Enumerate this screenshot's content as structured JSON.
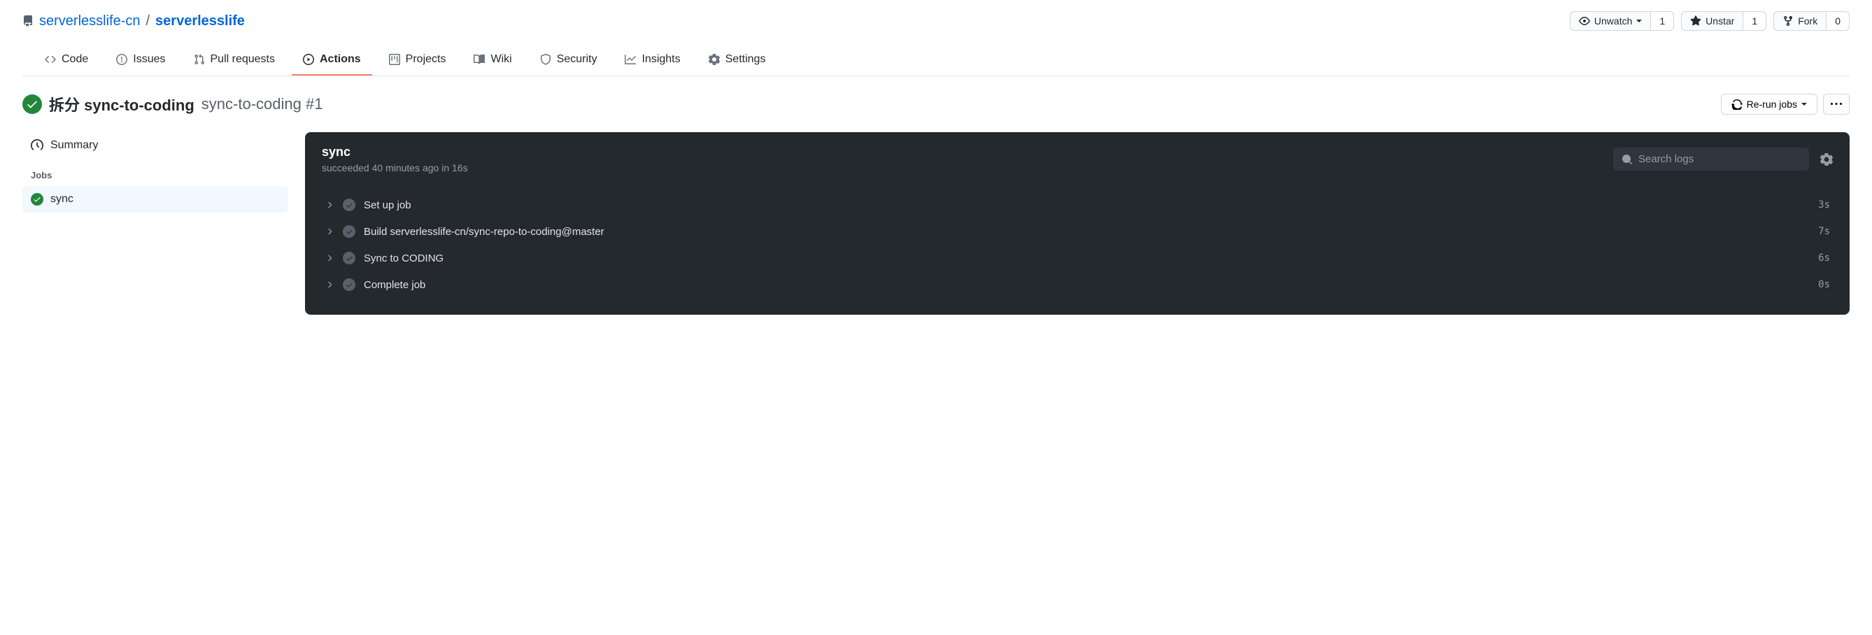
{
  "repo": {
    "owner": "serverlesslife-cn",
    "name": "serverlesslife"
  },
  "actions": {
    "watch": {
      "label": "Unwatch",
      "count": "1"
    },
    "star": {
      "label": "Unstar",
      "count": "1"
    },
    "fork": {
      "label": "Fork",
      "count": "0"
    }
  },
  "tabs": {
    "code": "Code",
    "issues": "Issues",
    "pulls": "Pull requests",
    "actions": "Actions",
    "projects": "Projects",
    "wiki": "Wiki",
    "security": "Security",
    "insights": "Insights",
    "settings": "Settings"
  },
  "run": {
    "title_prefix": "拆分 sync-to-coding",
    "workflow": "sync-to-coding #1",
    "rerun": "Re-run jobs"
  },
  "sidebar": {
    "summary": "Summary",
    "jobs_label": "Jobs",
    "job_name": "sync"
  },
  "log": {
    "title": "sync",
    "status": "succeeded 40 minutes ago in 16s",
    "search_placeholder": "Search logs",
    "steps": [
      {
        "name": "Set up job",
        "time": "3s"
      },
      {
        "name": "Build serverlesslife-cn/sync-repo-to-coding@master",
        "time": "7s"
      },
      {
        "name": "Sync to CODING",
        "time": "6s"
      },
      {
        "name": "Complete job",
        "time": "0s"
      }
    ]
  }
}
